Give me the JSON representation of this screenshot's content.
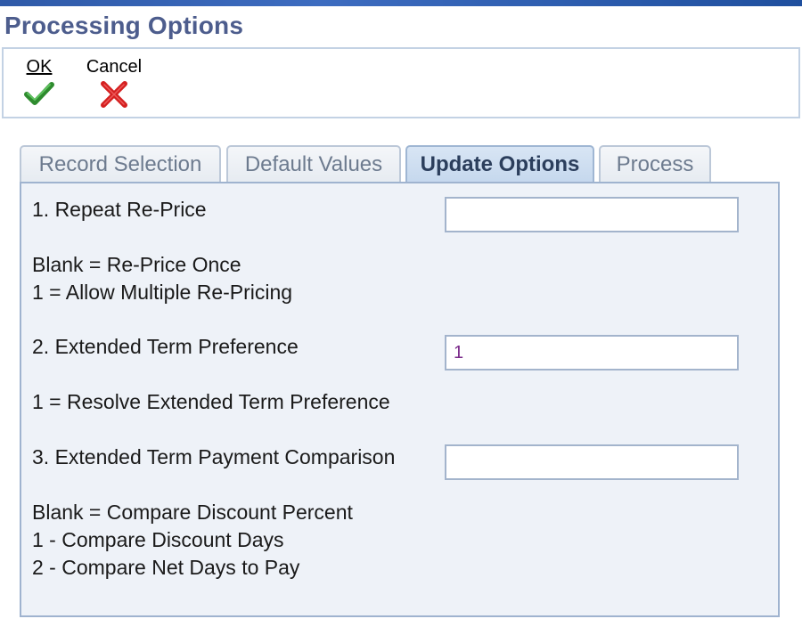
{
  "page": {
    "title": "Processing Options"
  },
  "toolbar": {
    "ok_label": "OK",
    "ok_icon": "checkmark-icon",
    "cancel_label": "Cancel",
    "cancel_icon": "x-icon",
    "ok_icon_color": "#2e8b2e",
    "cancel_icon_color": "#d42020"
  },
  "tabs": [
    {
      "label": "Record Selection",
      "active": false
    },
    {
      "label": "Default Values",
      "active": false
    },
    {
      "label": "Update Options",
      "active": true
    },
    {
      "label": "Process",
      "active": false
    }
  ],
  "options": [
    {
      "label": "1. Repeat Re-Price",
      "value": "",
      "help": [
        "Blank = Re-Price Once",
        "1 = Allow Multiple Re-Pricing"
      ]
    },
    {
      "label": "2. Extended Term Preference",
      "value": "1",
      "help": [
        "1 = Resolve Extended Term Preference"
      ]
    },
    {
      "label": "3. Extended Term Payment Comparison",
      "value": "",
      "help": [
        "Blank = Compare Discount Percent",
        "1 - Compare Discount Days",
        "2 - Compare Net Days to Pay"
      ]
    }
  ],
  "colors": {
    "title": "#4d5d8d",
    "panel_bg": "#eef2f8",
    "active_tab": "#c4d7ed",
    "field_value": "#7a2a8a"
  }
}
